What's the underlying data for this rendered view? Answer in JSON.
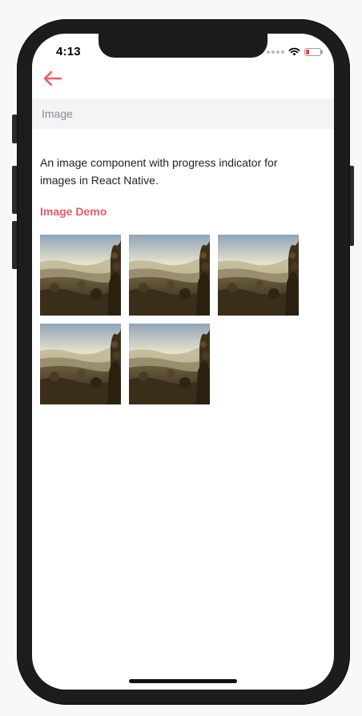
{
  "status_bar": {
    "time": "4:13"
  },
  "nav": {
    "back_icon": "arrow-left-icon",
    "accent_color": "#ec5a66"
  },
  "section": {
    "title": "Image"
  },
  "content": {
    "description": "An image component with progress indicator for images in React Native.",
    "demo_title": "Image Demo"
  },
  "images": [
    {
      "id": "landscape-1"
    },
    {
      "id": "landscape-2"
    },
    {
      "id": "landscape-3"
    },
    {
      "id": "landscape-4"
    },
    {
      "id": "landscape-5"
    }
  ]
}
